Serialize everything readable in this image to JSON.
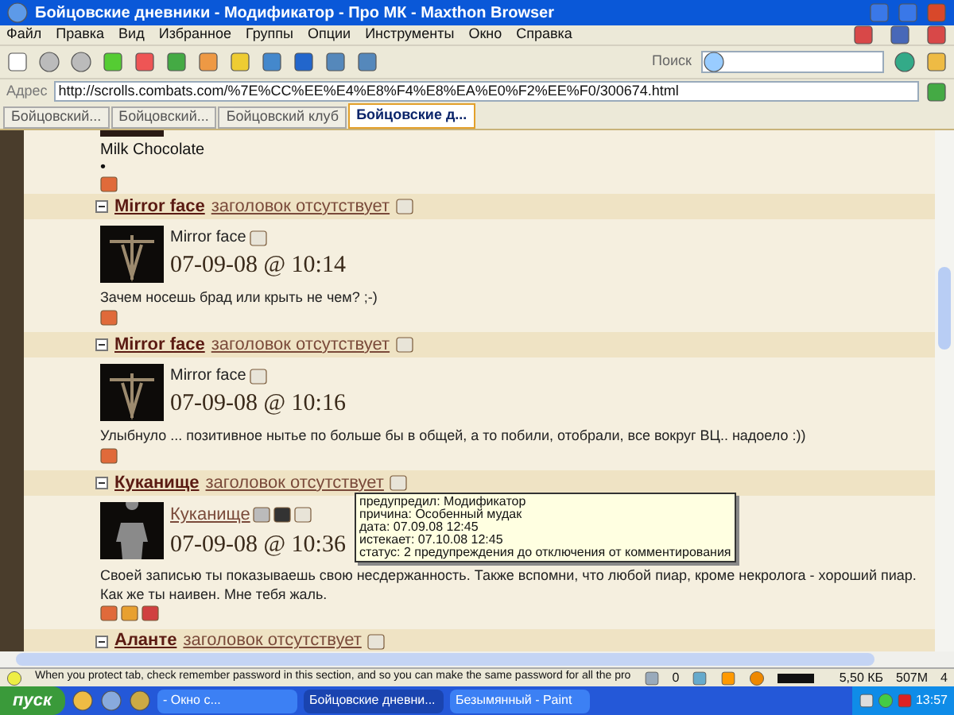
{
  "window": {
    "title": "Бойцовские дневники - Модификатор - Про МК - Maxthon Browser"
  },
  "menu": [
    "Файл",
    "Правка",
    "Вид",
    "Избранное",
    "Группы",
    "Опции",
    "Инструменты",
    "Окно",
    "Справка"
  ],
  "toolbar": {
    "search_label": "Поиск"
  },
  "address": {
    "label": "Адрес",
    "url": "http://scrolls.combats.com/%7E%CC%EE%E4%E8%F4%E8%EA%E0%F2%EE%F0/300674.html"
  },
  "tabs": [
    {
      "label": "Бойцовский...",
      "selected": false
    },
    {
      "label": "Бойцовский...",
      "selected": false
    },
    {
      "label": "Бойцовский клуб",
      "selected": false
    },
    {
      "label": "Бойцовские д...",
      "selected": true
    }
  ],
  "intro": {
    "name": "Milk Chocolate",
    "bullet": "•"
  },
  "entries": [
    {
      "kind": "post",
      "author": "Mirror face",
      "subject": "заголовок отсутствует",
      "post_author": "Mirror face",
      "date": "07-09-08 @ 10:14",
      "lines": [
        "Зачем носешь брад или крыть не чем? ;-)"
      ]
    },
    {
      "kind": "post",
      "author": "Mirror face",
      "subject": "заголовок отсутствует",
      "post_author": "Mirror face",
      "date": "07-09-08 @ 10:16",
      "lines": [
        "Улыбнуло ... позитивное нытье по больше бы в общей, а то побили, отобрали, все вокруг ВЦ.. надоело :))"
      ]
    },
    {
      "kind": "warned_post",
      "author": "Куканище",
      "subject": "заголовок отсутствует",
      "post_author": "Куканище",
      "date": "07-09-08 @ 10:36",
      "lines": [
        "Своей записью ты показываешь свою несдержанность. Также вспомни, что любой пиар, кроме некролога - хороший пиар.",
        "Как же ты наивен. Мне тебя жаль."
      ],
      "tooltip": [
        "предупредил: Модификатор",
        "причина: Особенный мудак",
        "дата: 07.09.08 12:45",
        "истекает: 07.10.08 12:45",
        "статус: 2 предупреждения до отключения от комментирования"
      ]
    },
    {
      "kind": "header",
      "author": "Аланте",
      "subject": "заголовок отсутствует"
    }
  ],
  "status_bar": {
    "message": "When you protect tab, check remember password in this section, and so you can make the same password for all the pro",
    "count": "0",
    "size": "5,50 КБ",
    "memory": "507M",
    "tabs": "4"
  },
  "taskbar": {
    "start": "пуск",
    "tasks": [
      {
        "label": "- Окно с...",
        "selected": false
      },
      {
        "label": "Бойцовские дневни...",
        "selected": true
      },
      {
        "label": "Безымянный - Paint",
        "selected": false
      }
    ],
    "clock": "13:57"
  }
}
